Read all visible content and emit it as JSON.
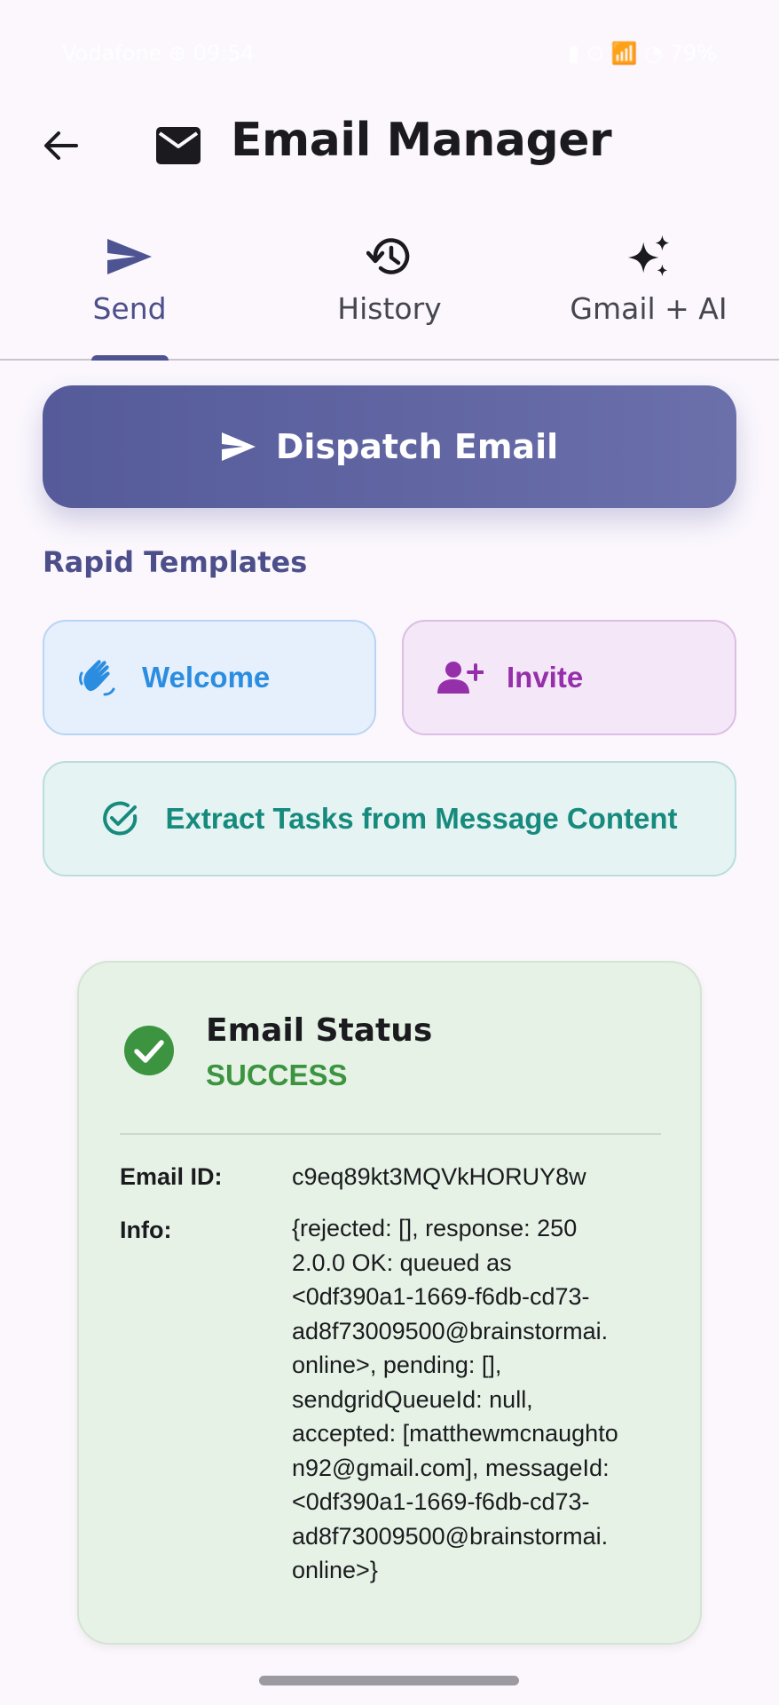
{
  "status_bar": {
    "left_text": "Vodafone  ⊕  09:54",
    "right_text": "▮ ⊙ 📶 ◔ 79%"
  },
  "app_bar": {
    "title": "Email Manager",
    "back_icon": "arrow-left-icon",
    "title_icon": "mail-icon"
  },
  "tabs": [
    {
      "label": "Send",
      "icon": "send-icon",
      "active": true
    },
    {
      "label": "History",
      "icon": "history-icon",
      "active": false
    },
    {
      "label": "Gmail + AI",
      "icon": "sparkles-icon",
      "active": false
    }
  ],
  "dispatch_button": {
    "label": "Dispatch Email",
    "icon": "send-icon"
  },
  "templates": {
    "section_title": "Rapid Templates",
    "items": [
      {
        "label": "Welcome",
        "icon": "waving-hand-icon",
        "color": "#2b8de0"
      },
      {
        "label": "Invite",
        "icon": "person-add-icon",
        "color": "#9530aa"
      },
      {
        "label": "Extract Tasks from Message Content",
        "icon": "check-circle-icon",
        "color": "#168a7d"
      }
    ]
  },
  "email_status": {
    "title": "Email Status",
    "status": "SUCCESS",
    "status_color": "#3c9440",
    "email_id_label": "Email ID:",
    "email_id": "c9eq89kt3MQVkHORUY8w",
    "info_label": "Info:",
    "info_lines": [
      "{rejected: [], response: 250",
      "2.0.0 OK: queued as",
      "<0df390a1-1669-f6db-cd73-",
      "ad8f73009500@brainstormai.",
      "online>, pending: [],",
      "sendgridQueueId: null,",
      "accepted: [matthewmcnaughto",
      "n92@gmail.com], messageId:",
      "<0df390a1-1669-f6db-cd73-",
      "ad8f73009500@brainstormai.",
      "online>}"
    ]
  }
}
